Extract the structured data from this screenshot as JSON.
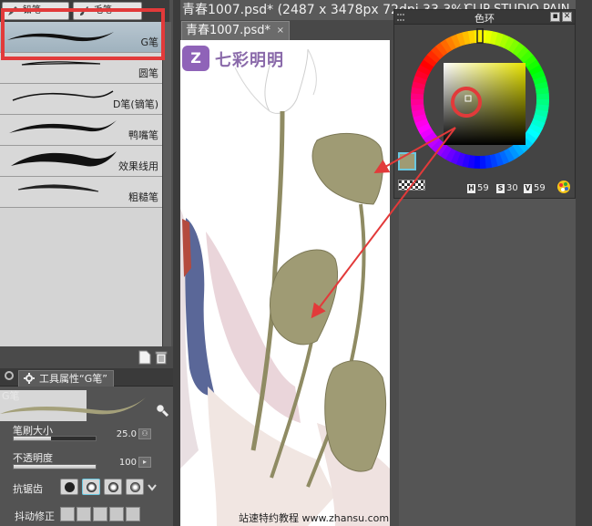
{
  "left_panel": {
    "subtabs": [
      {
        "label": "铅笔",
        "icon": "pencil-icon"
      },
      {
        "label": "毛笔",
        "icon": "brush-icon"
      }
    ],
    "brushes": [
      {
        "label": "G笔",
        "selected": true
      },
      {
        "label": "圆笔",
        "selected": false
      },
      {
        "label": "D笔(镝笔)",
        "selected": false
      },
      {
        "label": "鸭嘴笔",
        "selected": false
      },
      {
        "label": "效果线用",
        "selected": false
      },
      {
        "label": "粗糙笔",
        "selected": false
      }
    ],
    "footer_icons": [
      "new-preset-icon",
      "trash-icon"
    ]
  },
  "tool_properties": {
    "tab_label": "工具属性“G笔”",
    "tool_name": "G笔",
    "brush_size_label": "笔刷大小",
    "brush_size_value": "25.0",
    "brush_size_fraction": 0.45,
    "opacity_label": "不透明度",
    "opacity_value": "100",
    "opacity_fraction": 1.0,
    "antialias_label": "抗锯齿",
    "stabilization_label": "抖动修正"
  },
  "document": {
    "title": "青春1007.psd* (2487 x 3478px 72dpi 33.3%)",
    "app_title_fragment": "CLIP STUDIO PAIN",
    "tab_label": "青春1007.psd*",
    "tab_close": "×",
    "logo_badge": "Z",
    "logo_text": "七彩明明",
    "watermark": "站速特约教程 www.zhansu.com"
  },
  "color_wheel": {
    "title": "色环",
    "pin_button": "▪",
    "close_button": "✕",
    "h_label": "H",
    "h_value": "59",
    "s_label": "S",
    "s_value": "30",
    "v_label": "V",
    "v_value": "59",
    "hue_degrees": 59,
    "saturation": 30,
    "value": 59,
    "foreground_color": "#9f9b74"
  },
  "colors": {
    "highlight_red": "#e23a3a",
    "selected_brush": "#a9bac6",
    "leaf_olive": "#9f9b74"
  }
}
